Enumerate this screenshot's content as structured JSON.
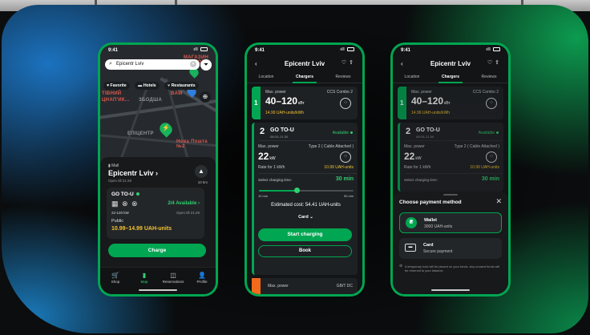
{
  "status": {
    "time": "9:41",
    "signal": "ıll"
  },
  "map_screen": {
    "search_value": "Epicentr Lviv",
    "chips": [
      "Favorite",
      "Hotels",
      "Restaurants"
    ],
    "map_labels": {
      "top_right": "МАГАЗИН ЧИСТОТИ",
      "left_a": "ТІВНИЙ",
      "left_b": "ЦНАП'ИК...",
      "mid": "ЗБОДША",
      "mid_right": "BAM",
      "epicentr": "ЕПІЦЕНТР",
      "nova": "Нова Пошта №2"
    },
    "place": {
      "category": "Mall",
      "title": "Epicentr Lviv",
      "title_arrow": "›",
      "hours": "Open till 21:29",
      "distance": "10 km"
    },
    "card": {
      "operator": "GO TO-U",
      "available": "2/4 Available",
      "kw_range": "22-120 kW",
      "open": "Open till 21:29",
      "access": "Public",
      "price": "10.99–14.99 UAH-units"
    },
    "charge_button": "Charge",
    "tabs": [
      {
        "icon": "🛒",
        "label": "Shop"
      },
      {
        "icon": "▮",
        "label": "Map"
      },
      {
        "icon": "◫",
        "label": "Reservations"
      },
      {
        "icon": "👤",
        "label": "Profile"
      }
    ]
  },
  "station_screen": {
    "title": "Epicentr Lviv",
    "tabs": [
      "Location",
      "Chargers",
      "Reviews"
    ],
    "active_tab": "Chargers",
    "charger1": {
      "number": "1",
      "max_power_label": "Max. power",
      "connector": "CCS Combo 2",
      "power": "40–120",
      "power_unit": "кВт",
      "rate": "14.99 UAH-units/kWh"
    },
    "charger2": {
      "number": "2",
      "operator": "GO TO-U",
      "hours": "08:00–21:30",
      "status": "Available",
      "max_power_label": "Max. power",
      "connector": "Type 2 ( Cable Attached )",
      "power": "22",
      "power_unit": "kW",
      "rate_label": "Rate for 1 kWh",
      "rate_value": "10.99 UAH-units",
      "time_label": "Select charging time:",
      "time_value": "30 min",
      "slider_min": "10 min",
      "slider_max": "90 min",
      "slider_fraction": 0.4,
      "estimated": "Estimated cost: 54.41 UAH-units",
      "payment": "Card",
      "start_button": "Start charging",
      "book_button": "Book"
    },
    "charger3": {
      "max_power_label": "Max. power",
      "connector": "GB/T DC"
    }
  },
  "payment_sheet": {
    "title": "Choose payment method",
    "wallet": {
      "name": "Wallet",
      "balance": "3000 UAH-units",
      "icon_letter": "₴"
    },
    "card": {
      "name": "Card",
      "sub": "Secure payment"
    },
    "note": "A temporary hold will be placed on your funds. Any unused funds will be returned to your balance."
  },
  "colors": {
    "accent": "#00a651",
    "price": "#f2c230",
    "orange": "#f26a1b"
  }
}
